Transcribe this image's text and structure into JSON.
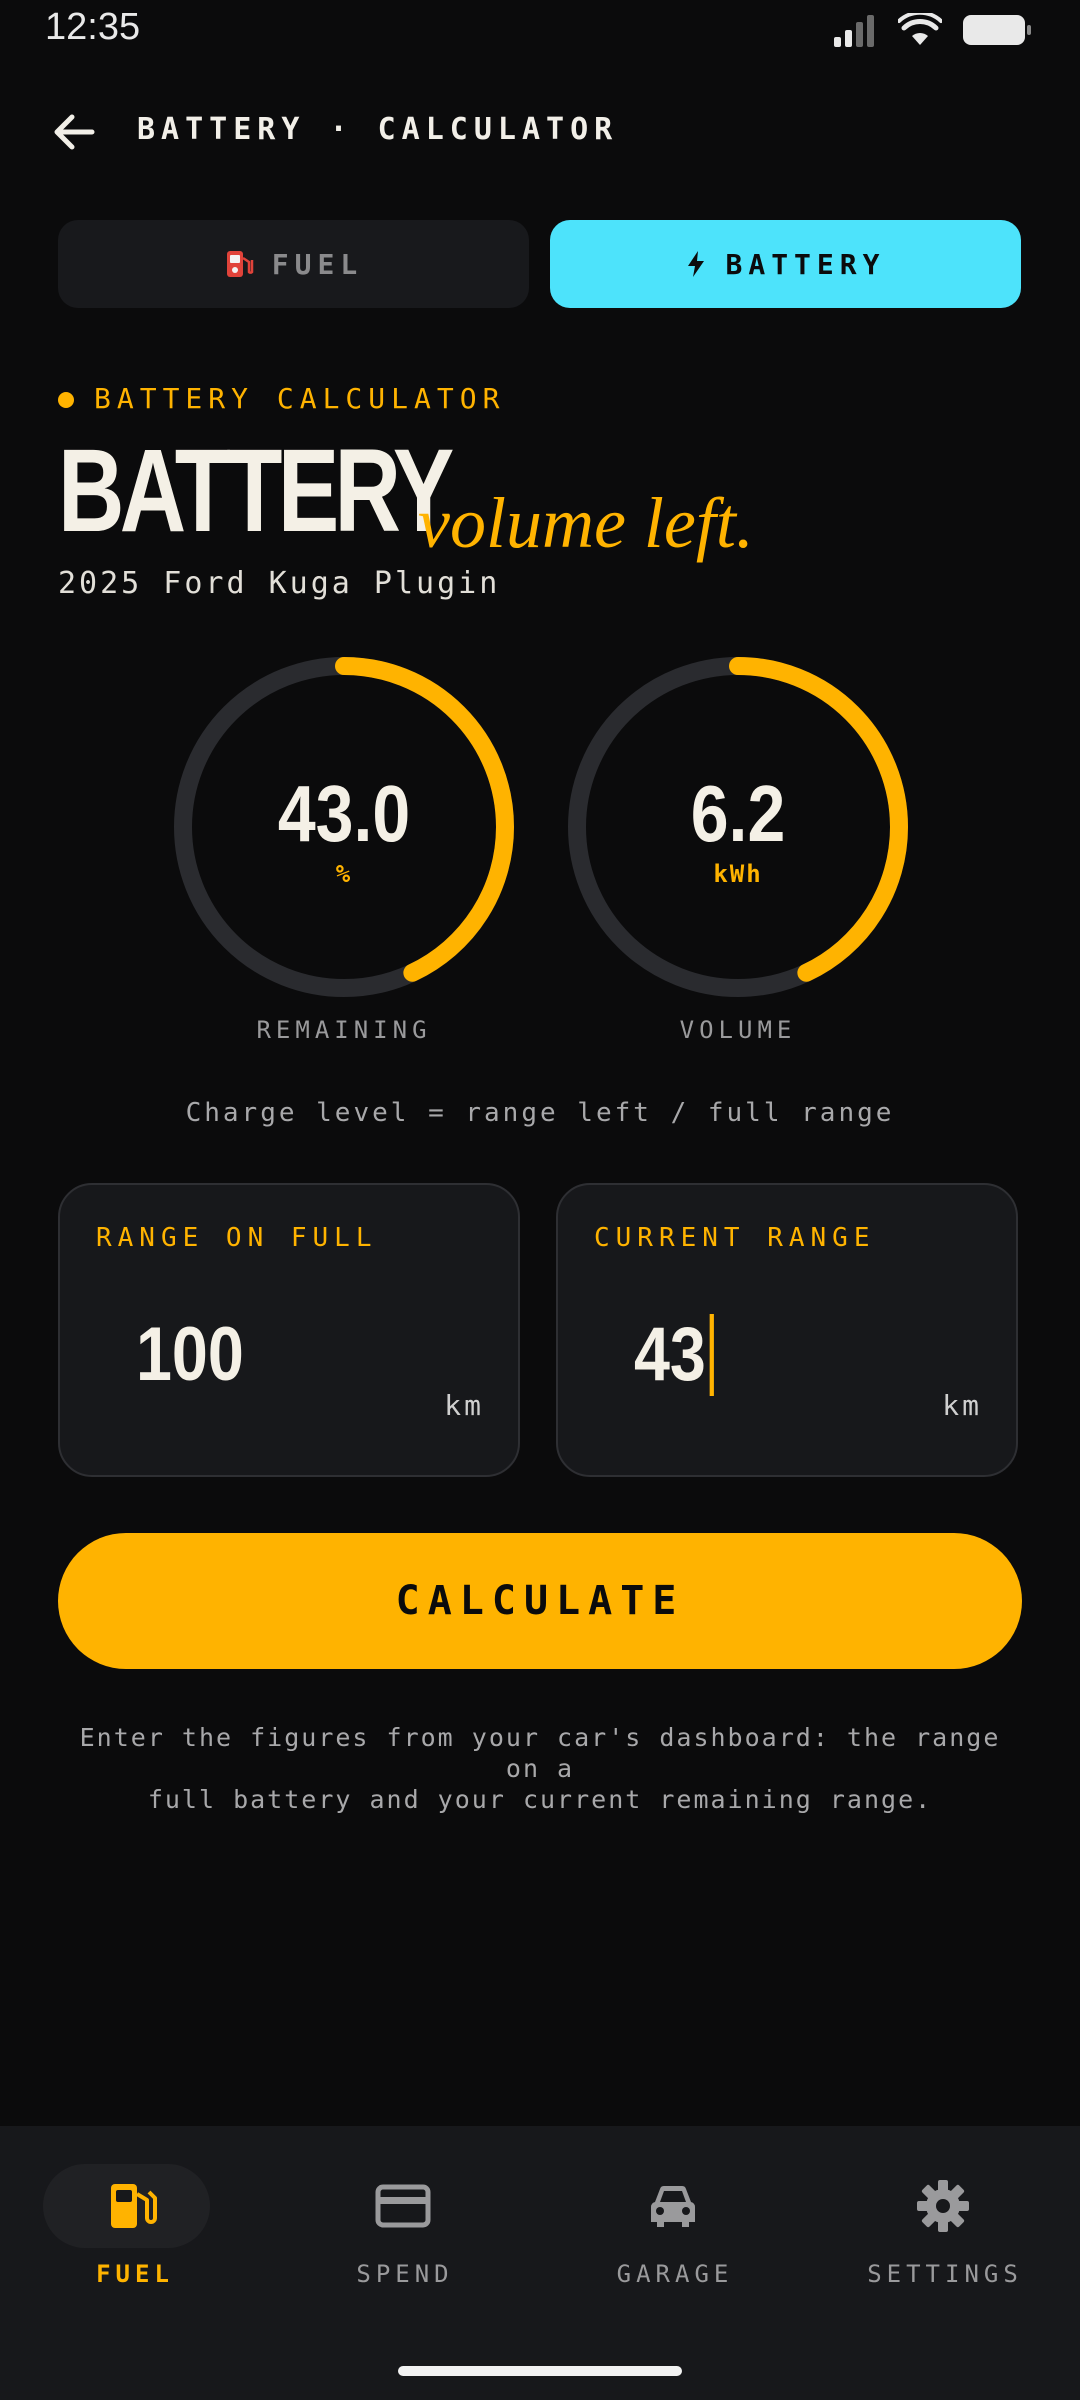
{
  "status": {
    "time": "12:35"
  },
  "header": {
    "title": "BATTERY · CALCULATOR"
  },
  "tabs": [
    {
      "label": "FUEL",
      "icon": "fuel-pump-icon",
      "active": false
    },
    {
      "label": "BATTERY",
      "icon": "lightning-icon",
      "active": true
    }
  ],
  "hero": {
    "eyebrow": "BATTERY CALCULATOR",
    "title": "BATTERY",
    "title_italic": "volume left.",
    "vehicle": "2025 Ford Kuga Plugin"
  },
  "gauges": [
    {
      "value": "43.0",
      "unit": "%",
      "label": "REMAINING",
      "fill_fraction": 0.43
    },
    {
      "value": "6.2",
      "unit": "kWh",
      "label": "VOLUME",
      "fill_fraction": 0.43
    }
  ],
  "formula": "Charge level = range left / full range",
  "inputs": {
    "full": {
      "label": "RANGE ON FULL",
      "value": "100",
      "unit": "km"
    },
    "current": {
      "label": "CURRENT RANGE",
      "value": "43",
      "unit": "km"
    }
  },
  "calculate_label": "CALCULATE",
  "help_text_line1": "Enter the figures from your car's dashboard: the range on a",
  "help_text_line2": "full battery and your current remaining range.",
  "nav": [
    {
      "label": "FUEL",
      "icon": "fuel-pump-icon",
      "active": true
    },
    {
      "label": "SPEND",
      "icon": "credit-card-icon",
      "active": false
    },
    {
      "label": "GARAGE",
      "icon": "car-icon",
      "active": false
    },
    {
      "label": "SETTINGS",
      "icon": "gear-icon",
      "active": false
    }
  ],
  "colors": {
    "accent": "#ffb300",
    "tab_active": "#4de3fb",
    "background": "#0b0b0c",
    "gauge_track": "#2a2b2f"
  }
}
